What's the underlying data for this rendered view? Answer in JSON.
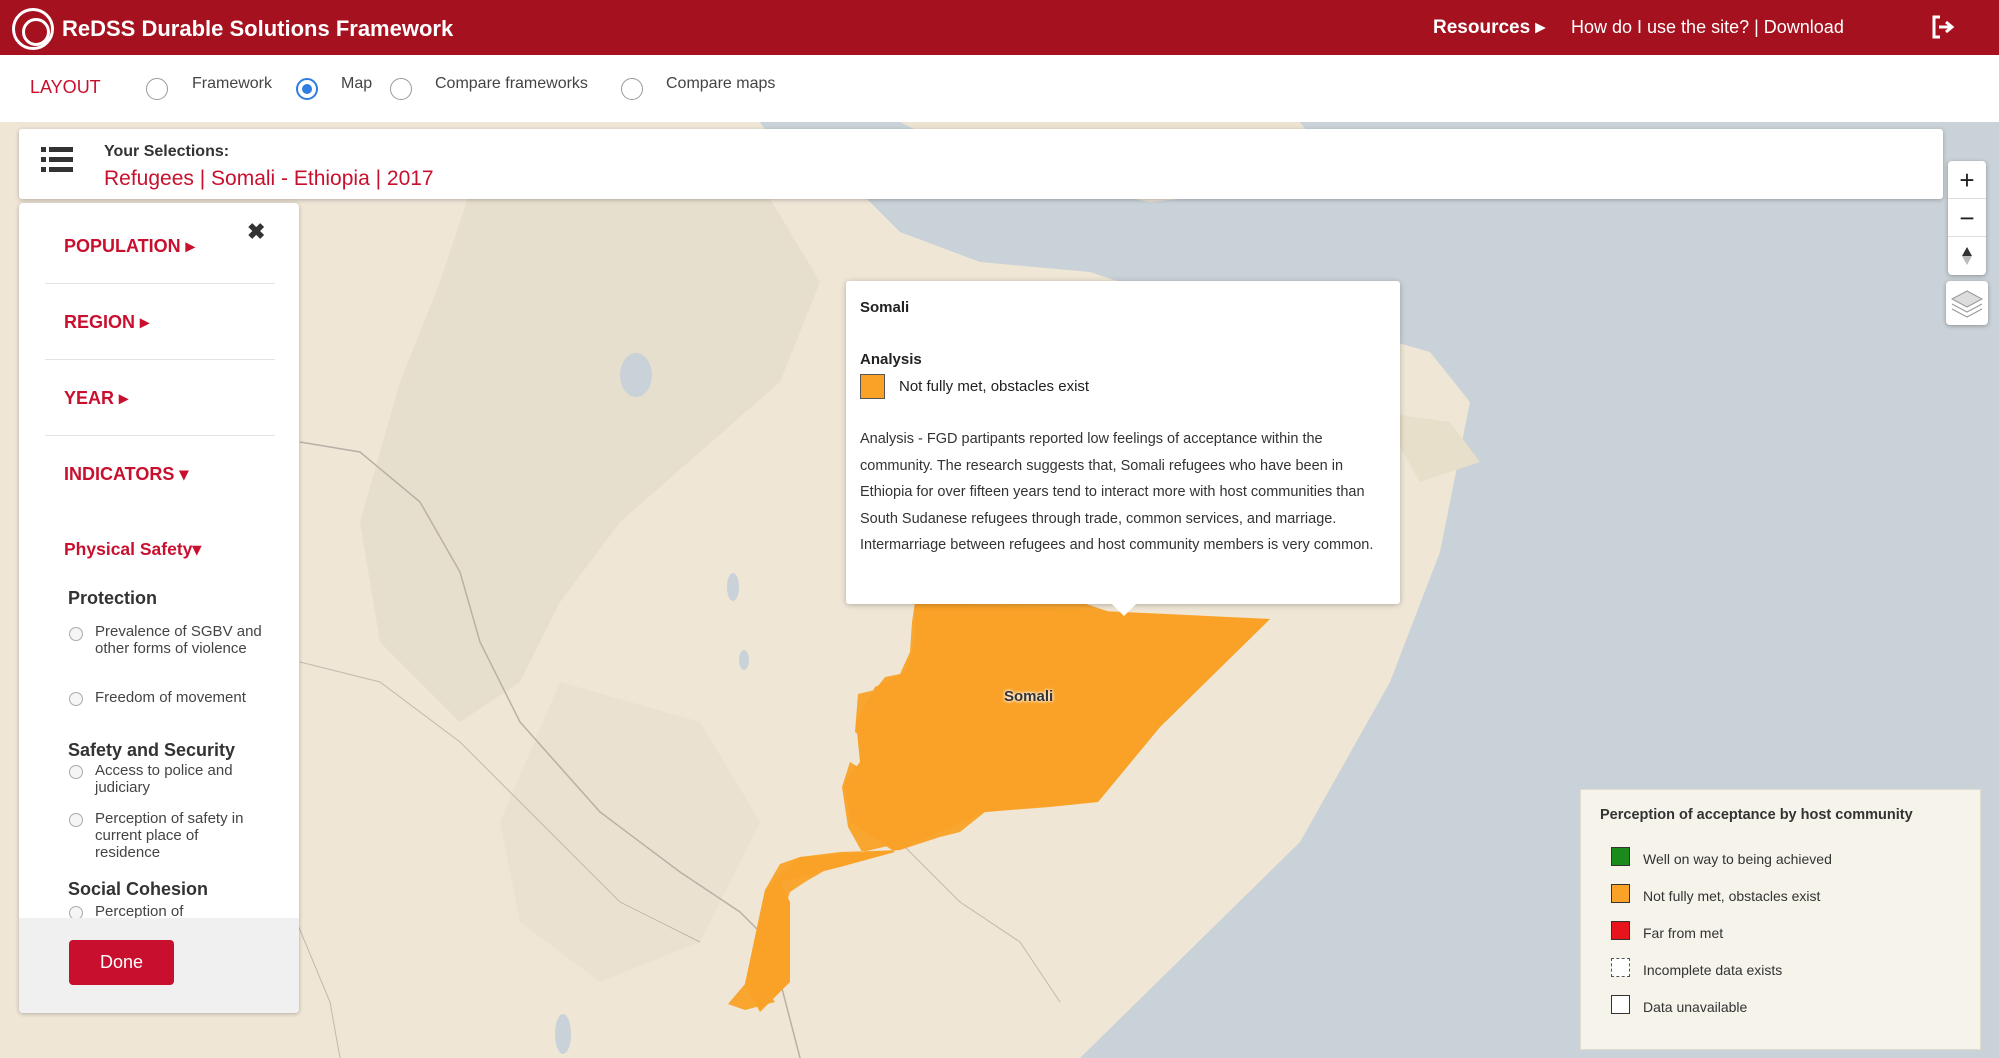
{
  "header": {
    "title": "ReDSS Durable Solutions Framework",
    "resources": "Resources ▸",
    "help_download": "How do I use the site? | Download"
  },
  "layout": {
    "label": "LAYOUT",
    "options": [
      {
        "label": "Framework",
        "selected": false
      },
      {
        "label": "Map",
        "selected": true
      },
      {
        "label": "Compare frameworks",
        "selected": false
      },
      {
        "label": "Compare maps",
        "selected": false
      }
    ]
  },
  "selections": {
    "title": "Your Selections:",
    "value": "Refugees | Somali - Ethiopia | 2017"
  },
  "sidebar": {
    "sections": [
      "POPULATION ▸",
      "REGION ▸",
      "YEAR ▸",
      "INDICATORS ▾"
    ],
    "indicator_group": "Physical Safety▾",
    "protection": {
      "heading": "Protection",
      "options": [
        "Prevalence of SGBV and other forms of violence",
        "Freedom of movement"
      ]
    },
    "safety": {
      "heading": "Safety and Security",
      "options": [
        "Access to police and judiciary",
        "Perception of safety in current place of residence"
      ]
    },
    "social": {
      "heading": "Social Cohesion",
      "partial_option": "Perception of"
    },
    "done_label": "Done"
  },
  "popup": {
    "title": "Somali",
    "analysis_heading": "Analysis",
    "status": "Not fully met, obstacles exist",
    "text": "Analysis - FGD partipants reported low feelings of acceptance within the community. The research suggests that, Somali refugees who have been in Ethiopia for over fifteen years tend to interact more with host communities than South Sudanese refugees through trade, common services, and marriage. Intermarriage between refugees and host community members is very common."
  },
  "map": {
    "region_label": "Somali",
    "region_color": "#f9a227"
  },
  "legend": {
    "title": "Perception of acceptance by host community",
    "items": [
      {
        "label": "Well on way to being achieved",
        "color": "#1a8a1a"
      },
      {
        "label": "Not fully met, obstacles exist",
        "color": "#f9a227"
      },
      {
        "label": "Far from met",
        "color": "#e8141c"
      },
      {
        "label": "Incomplete data exists",
        "color": "#ffffff"
      },
      {
        "label": "Data unavailable",
        "color": "#ffffff"
      }
    ]
  },
  "zoom": {
    "in": "+",
    "out": "−"
  }
}
